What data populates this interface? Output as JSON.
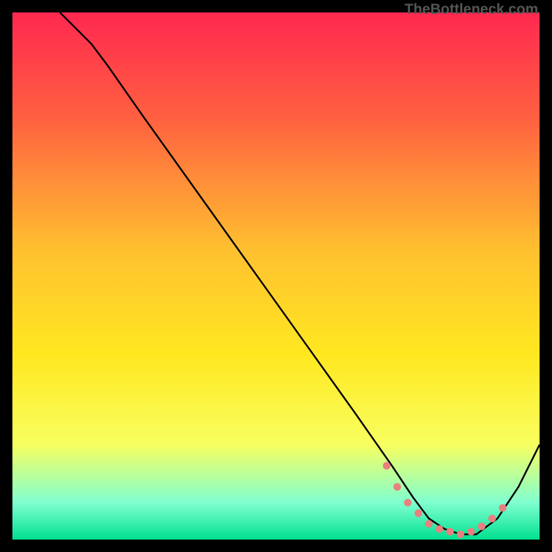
{
  "watermark": "TheBottleneck.com",
  "chart_data": {
    "type": "line",
    "title": "",
    "xlabel": "",
    "ylabel": "",
    "xlim": [
      0,
      100
    ],
    "ylim": [
      0,
      100
    ],
    "background_gradient": {
      "top": "#ff2850",
      "upper_mid": "#ff6040",
      "mid": "#ffc030",
      "lower_mid": "#ffe820",
      "low": "#f8ff60",
      "lowest": "#80ffd0",
      "bottom": "#00e090"
    },
    "curve": {
      "x": [
        9,
        12,
        15,
        18,
        25,
        35,
        45,
        55,
        65,
        72,
        76,
        79,
        82,
        85,
        88,
        92,
        96,
        100
      ],
      "y": [
        100,
        97,
        94,
        90,
        80,
        66,
        52,
        38,
        24,
        14,
        8,
        4,
        2,
        1,
        1,
        4,
        10,
        18
      ]
    },
    "highlight_points": {
      "x": [
        71,
        73,
        75,
        77,
        79,
        81,
        83,
        85,
        87,
        89,
        91,
        93
      ],
      "y": [
        14,
        10,
        7,
        5,
        3,
        2,
        1.5,
        1,
        1.5,
        2.5,
        4,
        6
      ],
      "color": "#e88080"
    }
  }
}
